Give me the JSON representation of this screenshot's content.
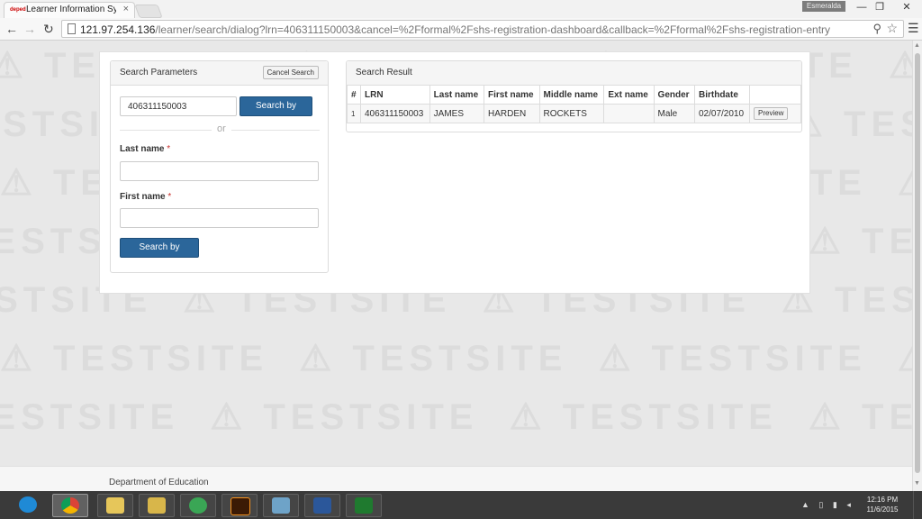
{
  "browser": {
    "tab_title": "Learner Information System",
    "tab_close": "×",
    "user_badge": "Esmeralda",
    "url_host": "121.97.254.136",
    "url_path": "/learner/search/dialog?lrn=406311150003&cancel=%2Fformal%2Fshs-registration-dashboard&callback=%2Fformal%2Fshs-registration-entry"
  },
  "search_params": {
    "title": "Search Parameters",
    "cancel_label": "Cancel Search",
    "lrn_value": "406311150003",
    "search_lrn_label": "Search by LRN",
    "or_text": "or",
    "last_name_label": "Last name",
    "first_name_label": "First name",
    "required_mark": "*",
    "search_name_label": "Search by Name"
  },
  "search_result": {
    "title": "Search Result",
    "columns": [
      "#",
      "LRN",
      "Last name",
      "First name",
      "Middle name",
      "Ext name",
      "Gender",
      "Birthdate",
      ""
    ],
    "rows": [
      {
        "num": "1",
        "lrn": "406311150003",
        "last_name": "JAMES",
        "first_name": "HARDEN",
        "middle_name": "ROCKETS",
        "ext_name": "",
        "gender": "Male",
        "birthdate": "02/07/2010",
        "action_label": "Preview"
      }
    ]
  },
  "watermark": {
    "text": "TESTSITE"
  },
  "footer": {
    "text": "Department of Education"
  },
  "taskbar": {
    "clock_time": "12:16 PM",
    "clock_date": "11/6/2015"
  },
  "colors": {
    "primary_button": "#2b669a",
    "required_asterisk": "#c9302c",
    "watermark": "#dcdcdc"
  }
}
